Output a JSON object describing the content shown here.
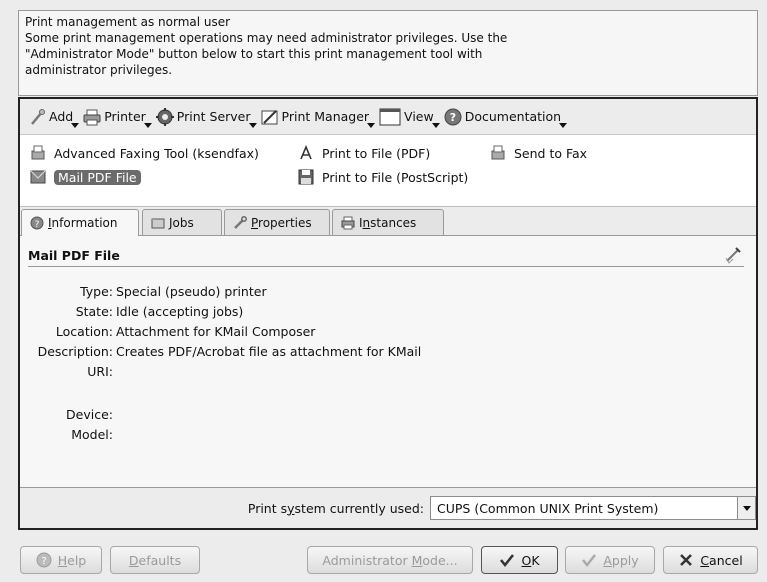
{
  "notice": {
    "lines": [
      "Print management as normal user",
      "Some print management operations may need administrator privileges. Use the",
      "\"Administrator Mode\" button below to start this print management tool with",
      "administrator privileges."
    ]
  },
  "toolbar": {
    "items": [
      {
        "label": "Add",
        "icon": "wand-icon"
      },
      {
        "label": "Printer",
        "icon": "printer-icon"
      },
      {
        "label": "Print Server",
        "icon": "gear-icon"
      },
      {
        "label": "Print Manager",
        "icon": "brush-icon"
      },
      {
        "label": "View",
        "icon": "window-icon"
      },
      {
        "label": "Documentation",
        "icon": "help-icon"
      }
    ]
  },
  "printers": [
    {
      "label": "Advanced Faxing Tool (ksendfax)",
      "icon": "fax-icon",
      "selected": false
    },
    {
      "label": "Print to File (PDF)",
      "icon": "pdf-icon",
      "selected": false
    },
    {
      "label": "Send to Fax",
      "icon": "fax-icon",
      "selected": false
    },
    {
      "label": "Mail PDF File",
      "icon": "mail-pdf-icon",
      "selected": true
    },
    {
      "label": "Print to File (PostScript)",
      "icon": "floppy-icon",
      "selected": false
    }
  ],
  "tabs": [
    {
      "label": "Information",
      "mnemonic": "I",
      "rest": "nformation",
      "active": true
    },
    {
      "label": "Jobs",
      "mnemonic": "J",
      "rest": "obs",
      "active": false
    },
    {
      "label": "Properties",
      "mnemonic": "P",
      "rest": "roperties",
      "active": false
    },
    {
      "label": "Instances",
      "pre": "I",
      "mnemonic": "n",
      "rest": "stances",
      "active": false
    }
  ],
  "info": {
    "title": "Mail PDF File",
    "rows": [
      {
        "key": "Type:",
        "value": "Special (pseudo) printer"
      },
      {
        "key": "State:",
        "value": "Idle (accepting jobs)"
      },
      {
        "key": "Location:",
        "value": "Attachment for KMail Composer"
      },
      {
        "key": "Description:",
        "value": "Creates PDF/Acrobat file as attachment for KMail"
      },
      {
        "key": "URI:",
        "value": ""
      },
      {
        "key": "Device:",
        "value": ""
      },
      {
        "key": "Model:",
        "value": ""
      }
    ]
  },
  "status": {
    "label_pre": "Print s",
    "label_mn": "y",
    "label_post": "stem currently used:",
    "selected": "CUPS (Common UNIX Print System)"
  },
  "buttons": {
    "help": {
      "mn": "H",
      "rest": "elp"
    },
    "defaults": {
      "mn": "D",
      "rest": "efaults"
    },
    "admin": {
      "pre": "Administrator ",
      "mn": "M",
      "rest": "ode..."
    },
    "ok": {
      "mn": "O",
      "rest": "K"
    },
    "apply": {
      "mn": "A",
      "rest": "pply"
    },
    "cancel": {
      "mn": "C",
      "rest": "ancel"
    }
  }
}
